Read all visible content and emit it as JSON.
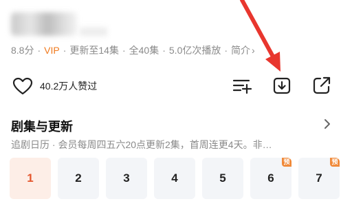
{
  "info": {
    "rating": "8.8分",
    "vip": "VIP",
    "updated": "更新至14集",
    "total": "全40集",
    "plays": "5.0亿次播放",
    "intro": "简介",
    "dot": "·",
    "chevron": "›"
  },
  "like": {
    "count_text": "40.2万人赞过"
  },
  "icons": {
    "heart": "heart-icon",
    "add_list": "add-to-list-icon",
    "download": "download-icon",
    "share": "share-icon",
    "annotation_arrow": "red-arrow-annotation"
  },
  "episodes_section": {
    "title": "剧集与更新",
    "subtitle": "追剧日历 · 会员每周四五六20点更新2集，首周连更4天。非…",
    "episodes": [
      {
        "label": "1",
        "active": true,
        "badge": ""
      },
      {
        "label": "2",
        "active": false,
        "badge": ""
      },
      {
        "label": "3",
        "active": false,
        "badge": ""
      },
      {
        "label": "4",
        "active": false,
        "badge": ""
      },
      {
        "label": "5",
        "active": false,
        "badge": ""
      },
      {
        "label": "6",
        "active": false,
        "badge": "预"
      },
      {
        "label": "7",
        "active": false,
        "badge": "预"
      }
    ]
  },
  "colors": {
    "vip": "#f07a1e",
    "active_episode_text": "#e4572e",
    "active_episode_bg": "#fdeee7",
    "episode_bg": "#f3f5f8",
    "badge": "#f08a3a",
    "annotation_arrow": "#e8362e"
  }
}
